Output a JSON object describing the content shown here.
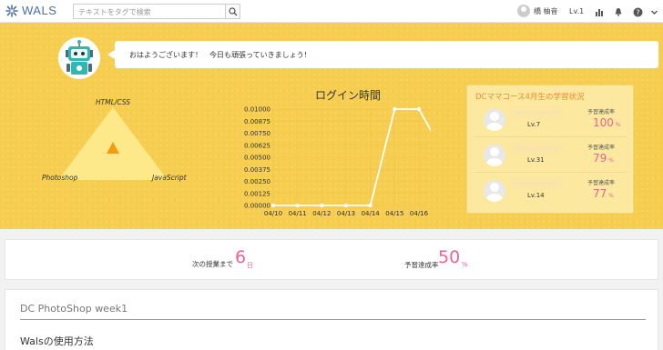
{
  "app": {
    "name": "WALS"
  },
  "search": {
    "placeholder": "テキストをタグで検索"
  },
  "user": {
    "name": "橋 柚音",
    "level": "Lv.1"
  },
  "greeting": {
    "message": "おはようございます！　今日も頑張っていきましょう！"
  },
  "skills": {
    "top": "HTML/CSS",
    "left": "Photoshop",
    "right": "JavaScript"
  },
  "chart_data": {
    "type": "line",
    "title": "ログイン時間",
    "categories": [
      "04/10",
      "04/11",
      "04/12",
      "04/13",
      "04/14",
      "04/15",
      "04/16"
    ],
    "series": [
      {
        "values": [
          0,
          0,
          0,
          0,
          0,
          0.01,
          0.01,
          0.0055
        ]
      }
    ],
    "y_ticks": [
      "0.01000",
      "0.00875",
      "0.00750",
      "0.00625",
      "0.00500",
      "0.00375",
      "0.00250",
      "0.00125",
      "0.00000"
    ],
    "ylim": [
      0,
      0.01
    ],
    "grid": true,
    "line_color": "#ffffff"
  },
  "status": {
    "title": "DCママコース4月生の学習状況",
    "rows": [
      {
        "level": "Lv.7",
        "label": "予習達成率",
        "value": "100",
        "unit": "%"
      },
      {
        "level": "Lv.31",
        "label": "予習達成率",
        "value": "79",
        "unit": "%"
      },
      {
        "level": "Lv.14",
        "label": "予習達成率",
        "value": "77",
        "unit": "%"
      }
    ]
  },
  "next": {
    "label": "次の授業まで",
    "value": "6",
    "unit": "日"
  },
  "achieve": {
    "label": "予習達成率",
    "value": "50",
    "unit": "%"
  },
  "course": {
    "title": "DC PhotoShop week1",
    "section": "Walsの使用方法"
  },
  "colors": {
    "accent": "#f06292",
    "background": "#f6cd4f",
    "triangle": "#fde98a",
    "marker": "#f39c12"
  }
}
